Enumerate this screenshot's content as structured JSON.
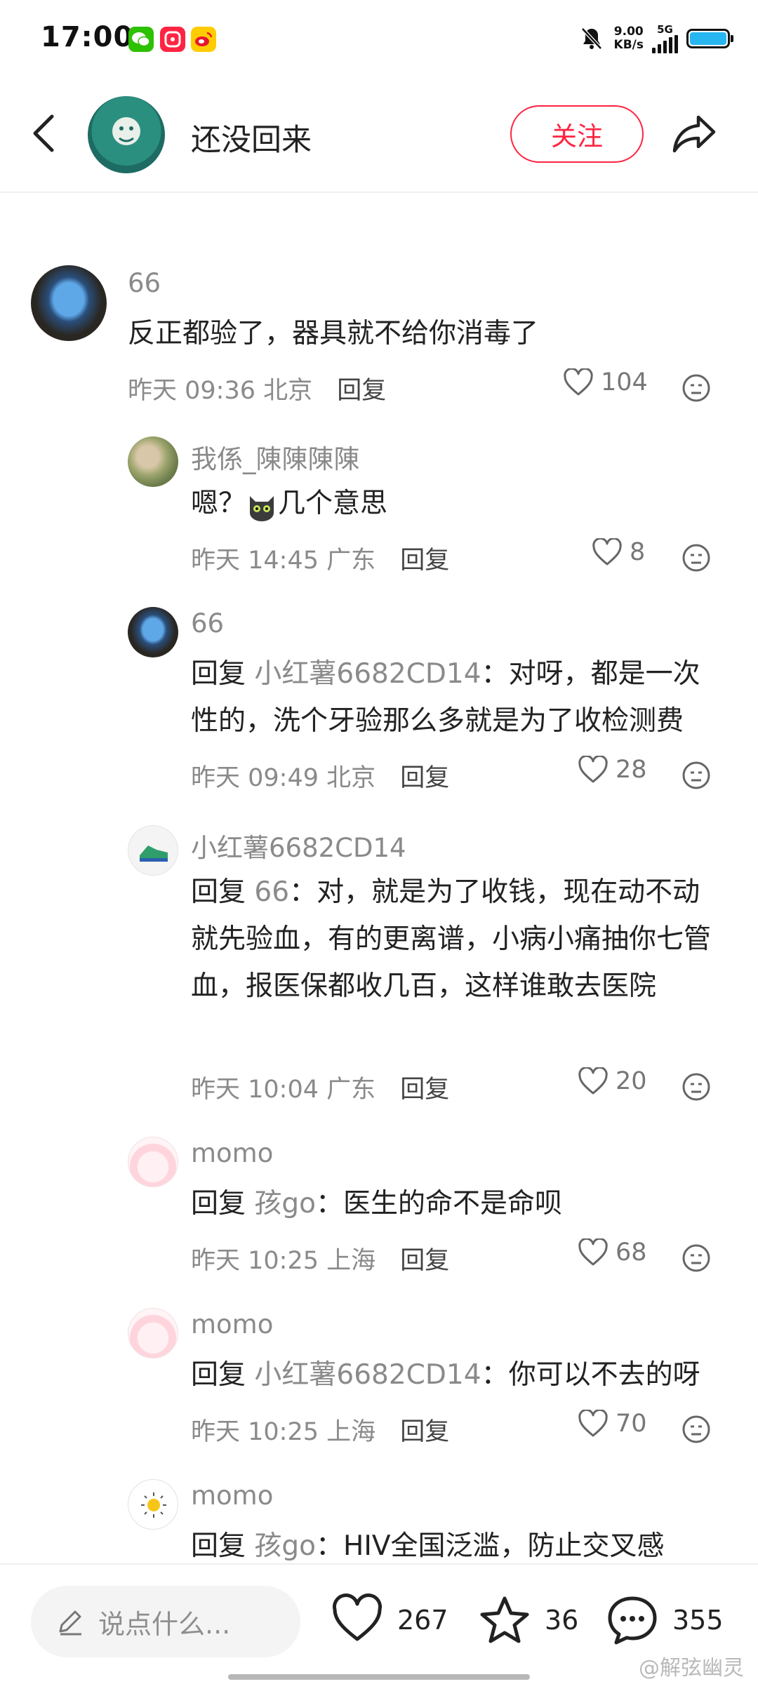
{
  "status_bar": {
    "time": "17:00",
    "apps": [
      "wechat-icon",
      "app-icon",
      "weibo-icon"
    ],
    "net_speed_value": "9.00",
    "net_speed_unit": "KB/s",
    "network": "5G"
  },
  "header": {
    "user_name": "还没回来",
    "follow_label": "关注"
  },
  "comments": [
    {
      "user": "66",
      "text": "反正都验了，器具就不给你消毒了",
      "time": "昨天 09:36",
      "location": "北京",
      "reply_label": "回复",
      "likes": "104"
    },
    {
      "user": "我係_陳陳陳陳",
      "text_prefix": "嗯？",
      "text_suffix": "几个意思",
      "time": "昨天 14:45",
      "location": "广东",
      "reply_label": "回复",
      "likes": "8"
    },
    {
      "user": "66",
      "reply_prefix": "回复",
      "reply_to": "小红薯6682CD14",
      "text": "：对呀，都是一次性的，洗个牙验那么多就是为了收检测费",
      "time": "昨天 09:49",
      "location": "北京",
      "reply_label": "回复",
      "likes": "28"
    },
    {
      "user": "小红薯6682CD14",
      "reply_prefix": "回复",
      "reply_to": "66",
      "text": "：对，就是为了收钱，现在动不动就先验血，有的更离谱，小病小痛抽你七管血，报医保都收几百，这样谁敢去医院",
      "time": "昨天 10:04",
      "location": "广东",
      "reply_label": "回复",
      "likes": "20"
    },
    {
      "user": "momo",
      "reply_prefix": "回复",
      "reply_to": "孩go",
      "text": "：医生的命不是命呗",
      "time": "昨天 10:25",
      "location": "上海",
      "reply_label": "回复",
      "likes": "68"
    },
    {
      "user": "momo",
      "reply_prefix": "回复",
      "reply_to": "小红薯6682CD14",
      "text": "：你可以不去的呀",
      "time": "昨天 10:25",
      "location": "上海",
      "reply_label": "回复",
      "likes": "70"
    },
    {
      "user": "momo",
      "reply_prefix": "回复",
      "reply_to": "孩go",
      "text": "：HIV全国泛滥，防止交叉感"
    }
  ],
  "bottom_bar": {
    "input_placeholder": "说点什么...",
    "likes": "267",
    "favorites": "36",
    "comments": "355"
  },
  "watermark": "@解弦幽灵",
  "colors": {
    "accent": "#ff2442",
    "meta_text": "#8a8a8a",
    "battery": "#27b6f0"
  }
}
